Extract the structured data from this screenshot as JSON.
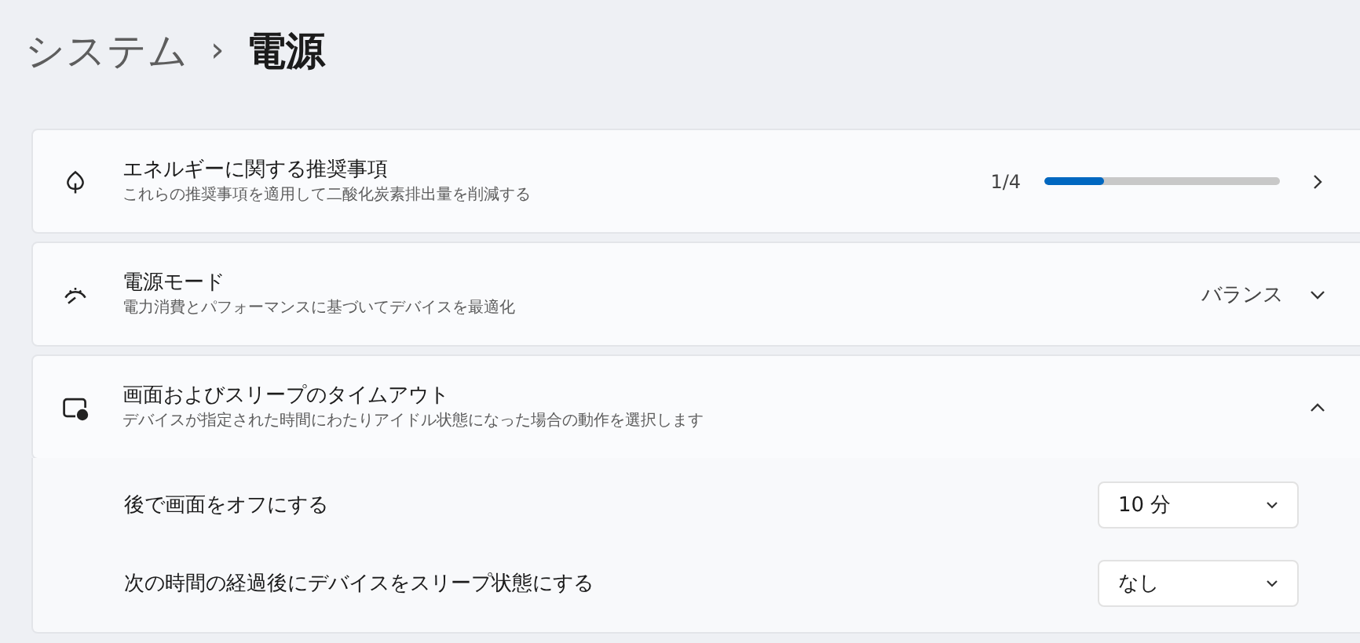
{
  "breadcrumb": {
    "parent": "システム",
    "separator": "›",
    "current": "電源"
  },
  "cards": [
    {
      "kind": "recommendations",
      "title": "エネルギーに関する推奨事項",
      "subtitle": "これらの推奨事項を適用して二酸化炭素排出量を削減する",
      "counter": "1/4",
      "level": 0.25
    },
    {
      "kind": "dropdown",
      "title": "電源モード",
      "subtitle": "電力消費とパフォーマンスに基づいてデバイスを最適化",
      "value": "バランス"
    },
    {
      "kind": "expander",
      "title": "画面およびスリープのタイムアウト",
      "subtitle": "デバイスが指定された時間にわたりアイドル状態になった場合の動作を選択します",
      "expanded": true,
      "settings": [
        {
          "label": "後で画面をオフにする",
          "value": "10 分"
        },
        {
          "label": "次の時間の経過後にデバイスをスリープ状態にする",
          "value": "なし"
        }
      ]
    }
  ]
}
